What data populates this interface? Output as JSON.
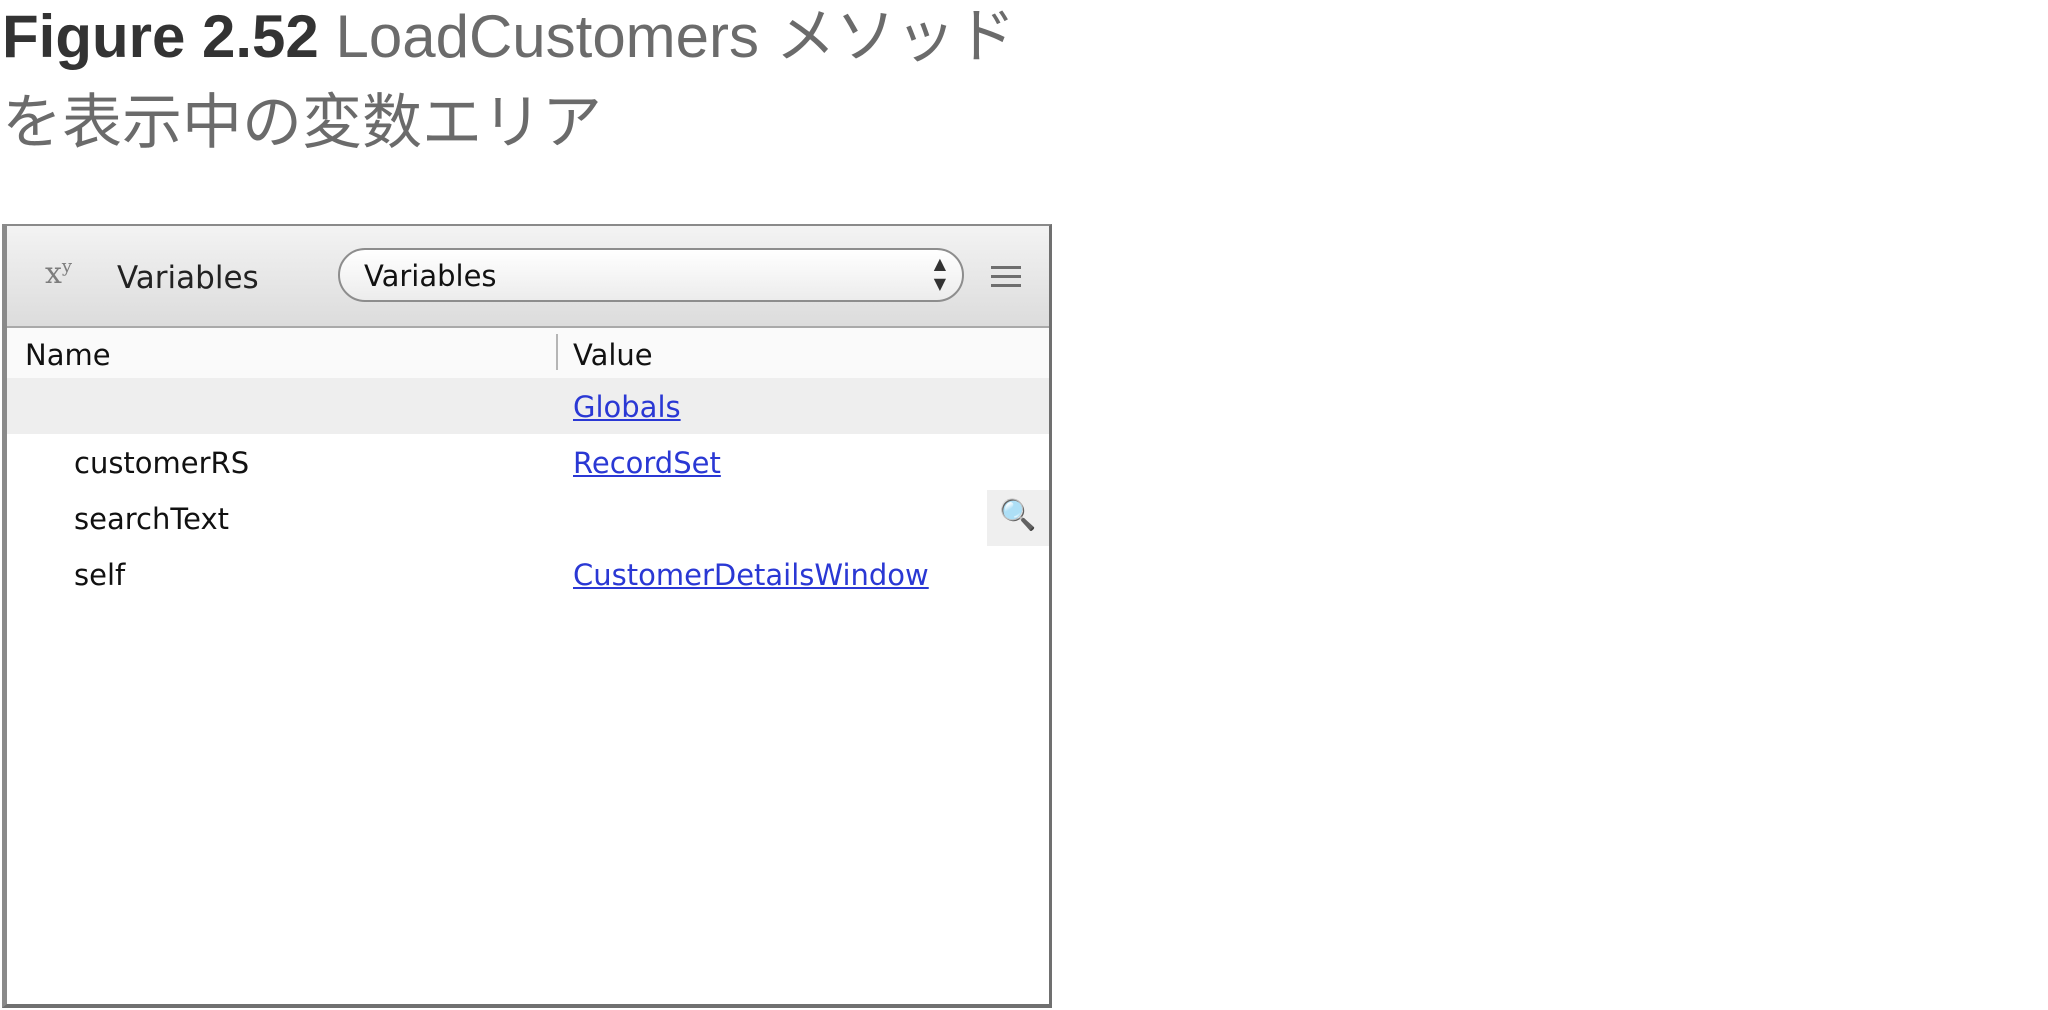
{
  "caption": {
    "label": "Figure 2.52",
    "text": " LoadCustomers メソッドを表示中の変数エリア"
  },
  "panel": {
    "icon": "variables-xy-icon",
    "title": "Variables",
    "scope_select": "Variables",
    "menu_icon": "hamburger-menu-icon"
  },
  "table": {
    "columns": [
      "Name",
      "Value"
    ],
    "rows": [
      {
        "name": "",
        "value": "Globals"
      },
      {
        "name": "customerRS",
        "value": "RecordSet"
      },
      {
        "name": "searchText",
        "value": "",
        "action_icon": "magnifier-pencil-icon"
      },
      {
        "name": "self",
        "value": "CustomerDetailsWindow"
      }
    ]
  }
}
